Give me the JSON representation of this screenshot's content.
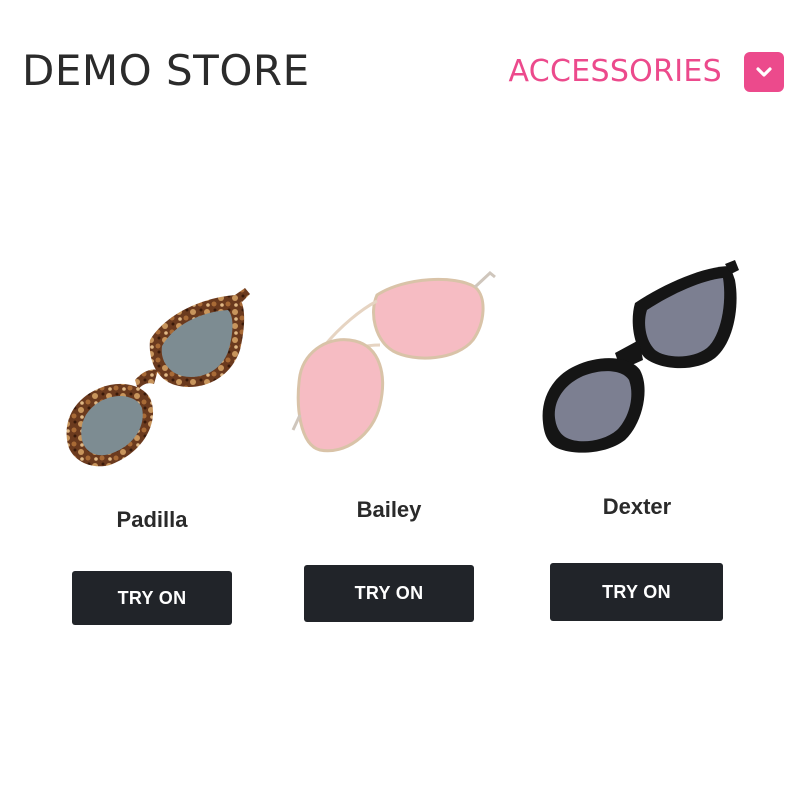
{
  "header": {
    "store_title": "DEMO STORE",
    "category_label": "ACCESSORIES",
    "dropdown_icon": "chevron-down-icon"
  },
  "theme": {
    "accent": "#ec4a8c",
    "button_bg": "#212429",
    "button_text": "#ffffff"
  },
  "products": [
    {
      "name": "Padilla",
      "button_label": "TRY ON",
      "frame": "tortoiseshell cat-eye"
    },
    {
      "name": "Bailey",
      "button_label": "TRY ON",
      "frame": "gold aviator with pink lenses"
    },
    {
      "name": "Dexter",
      "button_label": "TRY ON",
      "frame": "black square"
    }
  ]
}
